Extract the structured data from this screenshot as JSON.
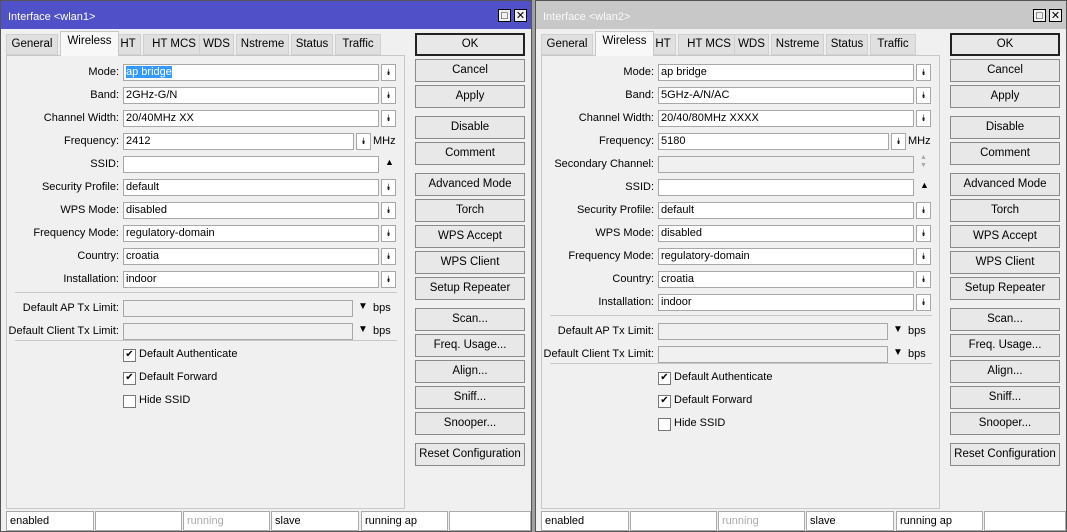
{
  "windows": [
    {
      "title": "Interface <wlan1>",
      "active": true,
      "tabs": [
        "General",
        "Wireless",
        "HT",
        "HT MCS",
        "WDS",
        "Nstreme",
        "Status",
        "Traffic"
      ],
      "active_tab": "Wireless",
      "rows": [
        {
          "label": "Mode:",
          "value": "ap bridge",
          "type": "dropdown",
          "selected": true
        },
        {
          "label": "Band:",
          "value": "2GHz-G/N",
          "type": "dropdown"
        },
        {
          "label": "Channel Width:",
          "value": "20/40MHz XX",
          "type": "dropdown"
        },
        {
          "label": "Frequency:",
          "value": "2412",
          "type": "freq",
          "unit": "MHz"
        },
        {
          "label": "SSID:",
          "value": "",
          "type": "up"
        },
        {
          "label": "Security Profile:",
          "value": "default",
          "type": "dropdown"
        },
        {
          "label": "WPS Mode:",
          "value": "disabled",
          "type": "dropdown"
        },
        {
          "label": "Frequency Mode:",
          "value": "regulatory-domain",
          "type": "dropdown"
        },
        {
          "label": "Country:",
          "value": "croatia",
          "type": "dropdown"
        },
        {
          "label": "Installation:",
          "value": "indoor",
          "type": "dropdown"
        }
      ],
      "limits": [
        {
          "label": "Default AP Tx Limit:",
          "value": "",
          "unit": "bps"
        },
        {
          "label": "Default Client Tx Limit:",
          "value": "",
          "unit": "bps"
        }
      ],
      "checkboxes": [
        {
          "label": "Default Authenticate",
          "checked": true
        },
        {
          "label": "Default Forward",
          "checked": true
        },
        {
          "label": "Hide SSID",
          "checked": false
        }
      ],
      "buttons": [
        "OK",
        "Cancel",
        "Apply",
        "Disable",
        "Comment",
        "Advanced Mode",
        "Torch",
        "WPS Accept",
        "WPS Client",
        "Setup Repeater",
        "Scan...",
        "Freq. Usage...",
        "Align...",
        "Sniff...",
        "Snooper...",
        "Reset Configuration"
      ],
      "status": [
        "enabled",
        "",
        "running",
        "slave",
        "running ap",
        ""
      ]
    },
    {
      "title": "Interface <wlan2>",
      "active": false,
      "tabs": [
        "General",
        "Wireless",
        "HT",
        "HT MCS",
        "WDS",
        "Nstreme",
        "Status",
        "Traffic"
      ],
      "active_tab": "Wireless",
      "rows": [
        {
          "label": "Mode:",
          "value": "ap bridge",
          "type": "dropdown"
        },
        {
          "label": "Band:",
          "value": "5GHz-A/N/AC",
          "type": "dropdown"
        },
        {
          "label": "Channel Width:",
          "value": "20/40/80MHz XXXX",
          "type": "dropdown"
        },
        {
          "label": "Frequency:",
          "value": "5180",
          "type": "freq",
          "unit": "MHz"
        },
        {
          "label": "Secondary Channel:",
          "value": "",
          "type": "updown"
        },
        {
          "label": "SSID:",
          "value": "",
          "type": "up"
        },
        {
          "label": "Security Profile:",
          "value": "default",
          "type": "dropdown"
        },
        {
          "label": "WPS Mode:",
          "value": "disabled",
          "type": "dropdown"
        },
        {
          "label": "Frequency Mode:",
          "value": "regulatory-domain",
          "type": "dropdown"
        },
        {
          "label": "Country:",
          "value": "croatia",
          "type": "dropdown"
        },
        {
          "label": "Installation:",
          "value": "indoor",
          "type": "dropdown"
        }
      ],
      "limits": [
        {
          "label": "Default AP Tx Limit:",
          "value": "",
          "unit": "bps"
        },
        {
          "label": "Default Client Tx Limit:",
          "value": "",
          "unit": "bps"
        }
      ],
      "checkboxes": [
        {
          "label": "Default Authenticate",
          "checked": true
        },
        {
          "label": "Default Forward",
          "checked": true
        },
        {
          "label": "Hide SSID",
          "checked": false
        }
      ],
      "buttons": [
        "OK",
        "Cancel",
        "Apply",
        "Disable",
        "Comment",
        "Advanced Mode",
        "Torch",
        "WPS Accept",
        "WPS Client",
        "Setup Repeater",
        "Scan...",
        "Freq. Usage...",
        "Align...",
        "Sniff...",
        "Snooper...",
        "Reset Configuration"
      ],
      "status": [
        "enabled",
        "",
        "running",
        "slave",
        "running ap",
        ""
      ]
    }
  ],
  "icons": {
    "maximize": "□",
    "close": "✕",
    "dropdown": "⯯",
    "up": "▲",
    "down": "▼",
    "check": "✔"
  }
}
